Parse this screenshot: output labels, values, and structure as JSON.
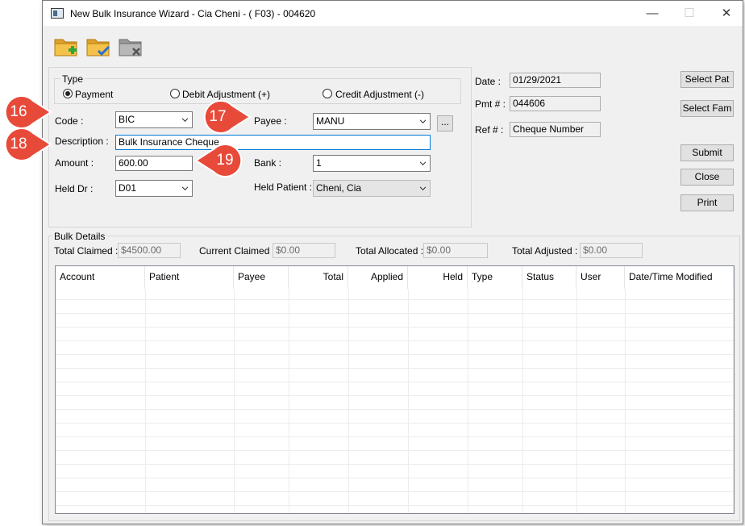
{
  "window": {
    "title": "New Bulk Insurance Wizard - Cia Cheni - ( F03) - 004620",
    "controls": {
      "minimize": "—",
      "maximize": "☐",
      "close": "✕"
    }
  },
  "toolbar": {
    "icons": [
      "folder-add-icon",
      "folder-check-icon",
      "folder-delete-icon"
    ]
  },
  "type_group": {
    "title": "Type",
    "options": [
      {
        "label": "Payment",
        "selected": true
      },
      {
        "label": "Debit Adjustment (+)",
        "selected": false
      },
      {
        "label": "Credit Adjustment (-)",
        "selected": false
      }
    ]
  },
  "form": {
    "code_label": "Code :",
    "code_value": "BIC",
    "payee_label": "Payee :",
    "payee_value": "MANU",
    "payee_lookup": "...",
    "description_label": "Description :",
    "description_value": "Bulk Insurance Cheque",
    "amount_label": "Amount :",
    "amount_value": "600.00",
    "bank_label": "Bank :",
    "bank_value": "1",
    "held_dr_label": "Held Dr :",
    "held_dr_value": "D01",
    "held_patient_label": "Held Patient :",
    "held_patient_value": "Cheni, Cia"
  },
  "info": {
    "date_label": "Date :",
    "date_value": "01/29/2021",
    "pmt_label": "Pmt # :",
    "pmt_value": "044606",
    "ref_label": "Ref # :",
    "ref_value": "Cheque Number"
  },
  "buttons": {
    "select_pat": "Select Pat",
    "select_fam": "Select Fam",
    "submit": "Submit",
    "close": "Close",
    "print": "Print"
  },
  "bulk": {
    "title": "Bulk Details",
    "total_claimed_label": "Total Claimed :",
    "total_claimed_value": "$4500.00",
    "current_claimed_label": "Current Claimed :",
    "current_claimed_value": "$0.00",
    "total_allocated_label": "Total Allocated :",
    "total_allocated_value": "$0.00",
    "total_adjusted_label": "Total Adjusted :",
    "total_adjusted_value": "$0.00",
    "columns": [
      "Account",
      "Patient",
      "Payee",
      "Total",
      "Applied",
      "Held",
      "Type",
      "Status",
      "User",
      "Date/Time Modified"
    ]
  },
  "callouts": [
    "16",
    "17",
    "18",
    "19"
  ],
  "colors": {
    "callout_red": "#e84a3a",
    "accent_blue": "#0078d7",
    "folder_yellow": "#f0b93a"
  }
}
